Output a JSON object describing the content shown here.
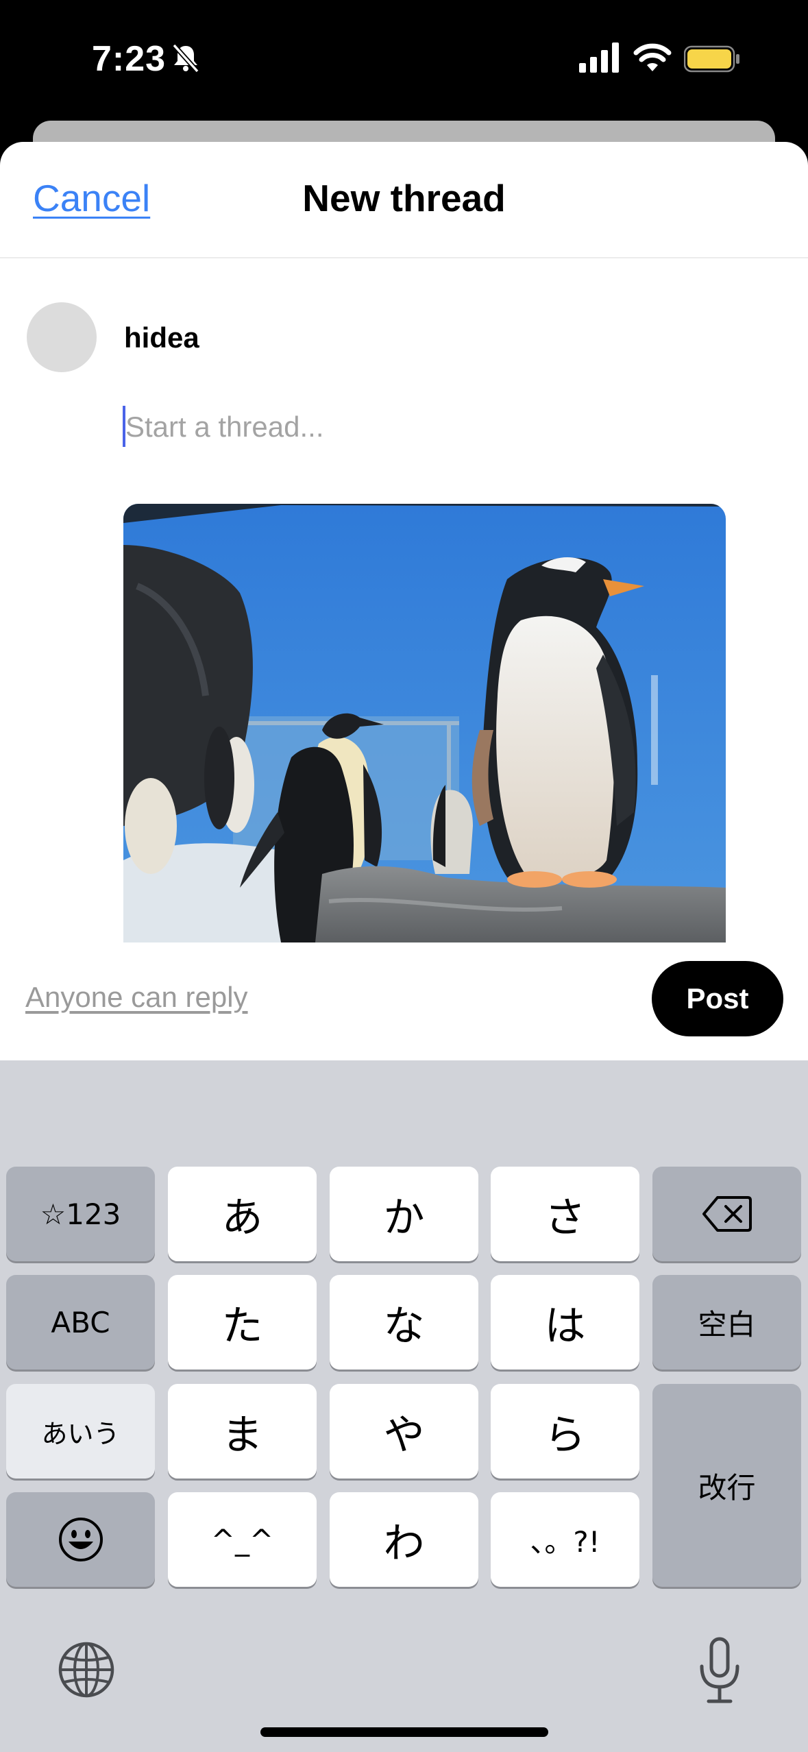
{
  "status_bar": {
    "time": "7:23",
    "icons": [
      "bell-slash-icon",
      "cellular-signal-icon",
      "wifi-icon",
      "battery-icon"
    ],
    "battery_color": "#f7d549"
  },
  "nav": {
    "cancel_label": "Cancel",
    "title": "New thread"
  },
  "composer": {
    "username": "hidea",
    "placeholder": "Start a thread...",
    "value": "",
    "attachment_icon": "penguin-photo"
  },
  "footer": {
    "reply_setting": "Anyone can reply",
    "post_label": "Post"
  },
  "keyboard": {
    "row1": [
      "☆123",
      "あ",
      "か",
      "さ"
    ],
    "row2": [
      "ABC",
      "た",
      "な",
      "は",
      "空白"
    ],
    "row3": [
      "あいう",
      "ま",
      "や",
      "ら"
    ],
    "row4": [
      "^_^",
      "わ",
      "、。?!"
    ],
    "return_label": "改行",
    "icons": [
      "backspace-icon",
      "emoji-icon",
      "globe-icon",
      "microphone-icon"
    ]
  },
  "colors": {
    "accent": "#3b82f6",
    "post_button": "#000000",
    "keyboard_bg": "#d1d3d9"
  }
}
